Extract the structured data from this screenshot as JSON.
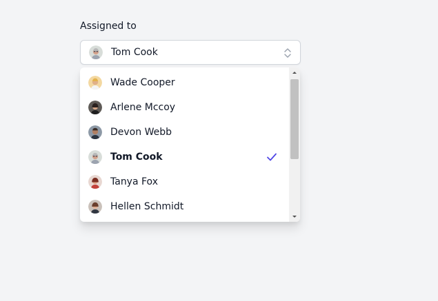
{
  "form": {
    "label": "Assigned to",
    "selected_value": "Tom Cook"
  },
  "options": [
    {
      "label": "Wade Cooper",
      "avatar": "avatar-wade-cooper"
    },
    {
      "label": "Arlene Mccoy",
      "avatar": "avatar-arlene-mccoy"
    },
    {
      "label": "Devon Webb",
      "avatar": "avatar-devon-webb"
    },
    {
      "label": "Tom Cook",
      "avatar": "avatar-tom-cook",
      "selected": true
    },
    {
      "label": "Tanya Fox",
      "avatar": "avatar-tanya-fox"
    },
    {
      "label": "Hellen Schmidt",
      "avatar": "avatar-hellen-schmidt"
    }
  ],
  "colors": {
    "page_bg": "#f3f4f6",
    "text": "#111827",
    "border": "#d1d5db",
    "check": "#4f46e5",
    "scroll_track": "#f1f1f1",
    "scroll_thumb": "#c1c1c1"
  },
  "icons": {
    "selector": "chevron-up-down-icon",
    "selected_marker": "check-icon",
    "scroll_up": "scroll-up-arrow-icon",
    "scroll_down": "scroll-down-arrow-icon"
  }
}
